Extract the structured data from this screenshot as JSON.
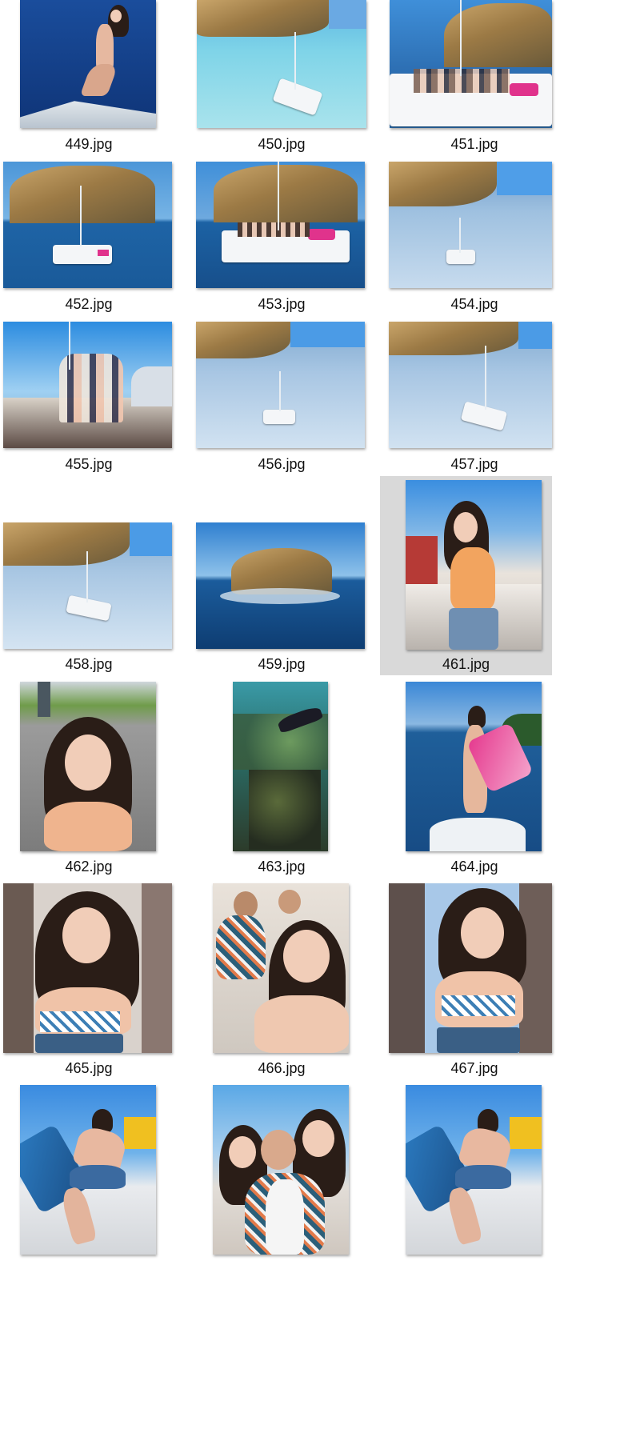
{
  "files": [
    {
      "name": "449.jpg",
      "icon": "photo-woman-bikini-boat-deck"
    },
    {
      "name": "450.jpg",
      "icon": "photo-aerial-catamaran-cliff"
    },
    {
      "name": "451.jpg",
      "icon": "photo-catamaran-group-cliff"
    },
    {
      "name": "452.jpg",
      "icon": "photo-catamaran-island-rock"
    },
    {
      "name": "453.jpg",
      "icon": "photo-catamaran-island-rock-close"
    },
    {
      "name": "454.jpg",
      "icon": "photo-aerial-boat-wake"
    },
    {
      "name": "455.jpg",
      "icon": "photo-group-on-boat-harbor"
    },
    {
      "name": "456.jpg",
      "icon": "photo-aerial-boat-wake"
    },
    {
      "name": "457.jpg",
      "icon": "photo-aerial-boat-wake"
    },
    {
      "name": "458.jpg",
      "icon": "photo-aerial-boat-wake"
    },
    {
      "name": "459.jpg",
      "icon": "photo-island-rock-sea"
    },
    {
      "name": "461.jpg",
      "icon": "photo-woman-orange-top-boat",
      "selected": true
    },
    {
      "name": "462.jpg",
      "icon": "photo-woman-selfie-parking"
    },
    {
      "name": "463.jpg",
      "icon": "photo-underwater-swimmer"
    },
    {
      "name": "464.jpg",
      "icon": "photo-woman-fins-boat"
    },
    {
      "name": "465.jpg",
      "icon": "photo-woman-selfie-bikini"
    },
    {
      "name": "466.jpg",
      "icon": "photo-group-selfie"
    },
    {
      "name": "467.jpg",
      "icon": "photo-woman-selfie-bikini"
    },
    {
      "name": "",
      "icon": "photo-woman-reclining-boat"
    },
    {
      "name": "",
      "icon": "photo-group-selfie-boat"
    },
    {
      "name": "",
      "icon": "photo-woman-reclining-boat"
    }
  ],
  "colors": {
    "selection": "#d9d9d9",
    "background": "#ffffff",
    "sea": "#1f5f9a",
    "sky": "#4d93d6"
  }
}
